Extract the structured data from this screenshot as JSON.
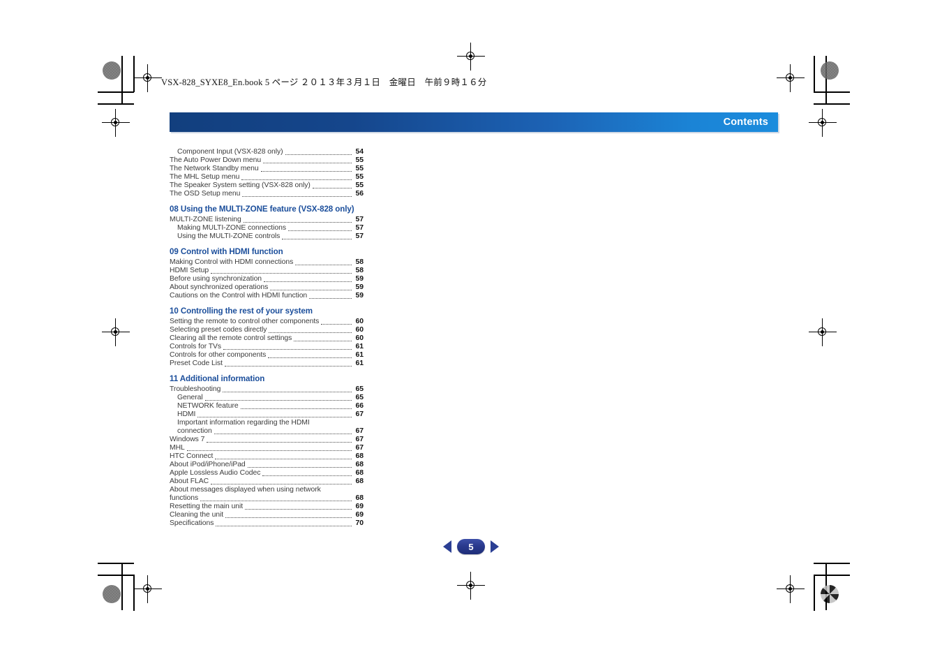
{
  "book_header": "VSX-828_SYXE8_En.book  5 ページ  ２０１３年３月１日　金曜日　午前９時１６分",
  "banner": {
    "title": "Contents",
    "gradient_start": "#123f7e",
    "gradient_end": "#1b8cdd"
  },
  "colors": {
    "heading": "#1b4e9b",
    "body": "#3b3b3b",
    "page_number": "#111111",
    "pill": "#2a3a8e"
  },
  "toc": [
    {
      "level": 2,
      "label": "Component Input (VSX-828 only)",
      "page": "54",
      "dots": true
    },
    {
      "level": 1,
      "label": "The Auto Power Down menu",
      "page": "55",
      "dots": true
    },
    {
      "level": 1,
      "label": "The Network Standby menu",
      "page": "55",
      "dots": true
    },
    {
      "level": 1,
      "label": "The MHL Setup menu",
      "page": "55",
      "dots": true
    },
    {
      "level": 1,
      "label": "The Speaker System setting (VSX-828 only)",
      "page": "55",
      "dots": true
    },
    {
      "level": 1,
      "label": "The OSD Setup menu",
      "page": "56",
      "dots": true
    },
    {
      "level": 0,
      "label": "08 Using the MULTI-ZONE feature (VSX-828 only)",
      "page": "",
      "dots": false
    },
    {
      "level": 1,
      "label": "MULTI-ZONE listening",
      "page": "57",
      "dots": true
    },
    {
      "level": 2,
      "label": "Making MULTI-ZONE connections",
      "page": "57",
      "dots": true
    },
    {
      "level": 2,
      "label": "Using the MULTI-ZONE controls",
      "page": "57",
      "dots": true
    },
    {
      "level": 0,
      "label": "09 Control with HDMI function",
      "page": "",
      "dots": false
    },
    {
      "level": 1,
      "label": "Making Control with HDMI connections",
      "page": "58",
      "dots": true
    },
    {
      "level": 1,
      "label": "HDMI Setup",
      "page": "58",
      "dots": true
    },
    {
      "level": 1,
      "label": "Before using synchronization",
      "page": "59",
      "dots": true
    },
    {
      "level": 1,
      "label": "About synchronized operations",
      "page": "59",
      "dots": true
    },
    {
      "level": 1,
      "label": "Cautions on the Control with HDMI function",
      "page": "59",
      "dots": true
    },
    {
      "level": 0,
      "label": "10 Controlling the rest of your system",
      "page": "",
      "dots": false
    },
    {
      "level": 1,
      "label": "Setting the remote to control other components",
      "page": "60",
      "dots": true
    },
    {
      "level": 1,
      "label": "Selecting preset codes directly",
      "page": "60",
      "dots": true
    },
    {
      "level": 1,
      "label": "Clearing all the remote control settings",
      "page": "60",
      "dots": true
    },
    {
      "level": 1,
      "label": "Controls for TVs",
      "page": "61",
      "dots": true
    },
    {
      "level": 1,
      "label": "Controls for other components",
      "page": "61",
      "dots": true
    },
    {
      "level": 1,
      "label": "Preset Code List",
      "page": "61",
      "dots": true
    },
    {
      "level": 0,
      "label": "11 Additional information",
      "page": "",
      "dots": false
    },
    {
      "level": 1,
      "label": "Troubleshooting",
      "page": "65",
      "dots": true
    },
    {
      "level": 2,
      "label": "General",
      "page": "65",
      "dots": true
    },
    {
      "level": 2,
      "label": "NETWORK feature",
      "page": "66",
      "dots": true
    },
    {
      "level": 2,
      "label": "HDMI",
      "page": "67",
      "dots": true
    },
    {
      "level": 2,
      "label": "Important information regarding the HDMI",
      "page": "",
      "dots": false
    },
    {
      "level": 2,
      "label": "connection",
      "page": "67",
      "dots": true
    },
    {
      "level": 1,
      "label": "Windows 7",
      "page": "67",
      "dots": true
    },
    {
      "level": 1,
      "label": "MHL",
      "page": "67",
      "dots": true
    },
    {
      "level": 1,
      "label": "HTC Connect",
      "page": "68",
      "dots": true
    },
    {
      "level": 1,
      "label": "About iPod/iPhone/iPad",
      "page": "68",
      "dots": true
    },
    {
      "level": 1,
      "label": "Apple Lossless Audio Codec",
      "page": "68",
      "dots": true
    },
    {
      "level": 1,
      "label": "About FLAC",
      "page": "68",
      "dots": true
    },
    {
      "level": 1,
      "label": "About messages displayed when using network",
      "page": "",
      "dots": false
    },
    {
      "level": 1,
      "label": "functions",
      "page": "68",
      "dots": true
    },
    {
      "level": 1,
      "label": "Resetting the main unit",
      "page": "69",
      "dots": true
    },
    {
      "level": 1,
      "label": "Cleaning the unit",
      "page": "69",
      "dots": true
    },
    {
      "level": 1,
      "label": "Specifications",
      "page": "70",
      "dots": true
    }
  ],
  "footer": {
    "page_number": "5",
    "prev_label": "◀",
    "next_label": "▶"
  }
}
